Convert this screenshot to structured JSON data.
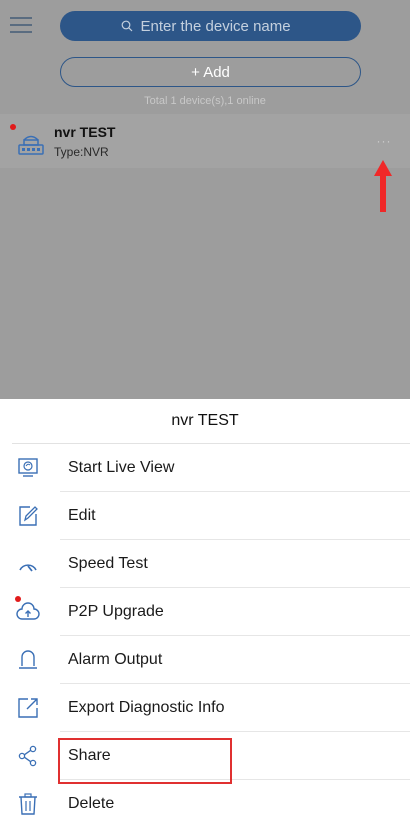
{
  "search": {
    "placeholder": "Enter the device name"
  },
  "add_button": {
    "label": "+ Add"
  },
  "summary": "Total 1 device(s),1 online",
  "device": {
    "name": "nvr TEST",
    "type": "Type:NVR",
    "more": "···"
  },
  "sheet": {
    "title": "nvr TEST",
    "items": [
      {
        "label": "Start Live View",
        "icon": "monitor-icon"
      },
      {
        "label": "Edit",
        "icon": "edit-icon"
      },
      {
        "label": "Speed Test",
        "icon": "speedometer-icon"
      },
      {
        "label": "P2P Upgrade",
        "icon": "cloud-upload-icon"
      },
      {
        "label": "Alarm Output",
        "icon": "alarm-light-icon"
      },
      {
        "label": "Export Diagnostic Info",
        "icon": "export-icon"
      },
      {
        "label": "Share",
        "icon": "share-icon"
      },
      {
        "label": "Delete",
        "icon": "trash-icon"
      }
    ]
  },
  "colors": {
    "accent": "#2d5688",
    "icon_blue": "#3a6fb5",
    "alert_red": "#e11b1b",
    "overlay": "#9d9d9d"
  }
}
